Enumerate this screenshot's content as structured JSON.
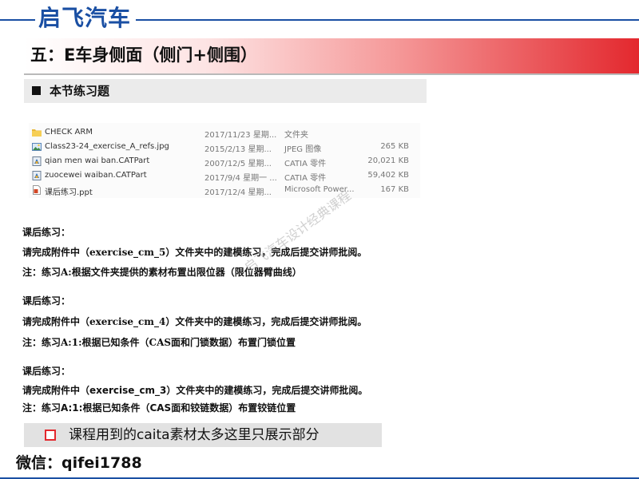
{
  "brand": "启飞汽车",
  "section_title": "五：E车身侧面（侧门+侧围）",
  "sub_header": "本节练习题",
  "files": [
    {
      "icon": "folder-icon",
      "name": "CHECK ARM",
      "date": "2017/11/23 星期...",
      "type": "文件夹",
      "size": ""
    },
    {
      "icon": "image-file-icon",
      "name": "Class23-24_exercise_A_refs.jpg",
      "date": "2015/2/13 星期...",
      "type": "JPEG 图像",
      "size": "265 KB"
    },
    {
      "icon": "catia-file-icon",
      "name": "qian men wai ban.CATPart",
      "date": "2007/12/5 星期...",
      "type": "CATIA 零件",
      "size": "20,021 KB"
    },
    {
      "icon": "catia-file-icon",
      "name": "zuocewei waiban.CATPart",
      "date": "2017/9/4 星期一 ...",
      "type": "CATIA 零件",
      "size": "59,402 KB"
    },
    {
      "icon": "ppt-file-icon",
      "name": "课后练习.ppt",
      "date": "2017/12/4 星期...",
      "type": "Microsoft Power...",
      "size": "167 KB"
    }
  ],
  "exercises": [
    {
      "heading": "课后练习：",
      "instruction": "请完成附件中（exercise_cm_5）文件夹中的建模练习，完成后提交讲师批阅。",
      "note": "注：练习A:根据文件夹提供的素材布置出限位器（限位器臂曲线）"
    },
    {
      "heading": "课后练习：",
      "instruction": "请完成附件中（exercise_cm_4）文件夹中的建模练习，完成后提交讲师批阅。",
      "note": "注：练习A:1:根据已知条件（CAS面和门锁数据）布置门锁位置"
    },
    {
      "heading": "课后练习：",
      "instruction": "请完成附件中（exercise_cm_3）文件夹中的建模练习，完成后提交讲师批阅。",
      "note": "注：练习A:1:根据已知条件（CAS面和铰链数据）布置铰链位置"
    }
  ],
  "watermark": "启飞汽车设计经典课程",
  "notice": "课程用到的caita素材太多这里只展示部分",
  "wechat": "微信：qifei1788",
  "colors": {
    "brand_blue": "#1a4fa3",
    "accent_red": "#e3282e"
  }
}
